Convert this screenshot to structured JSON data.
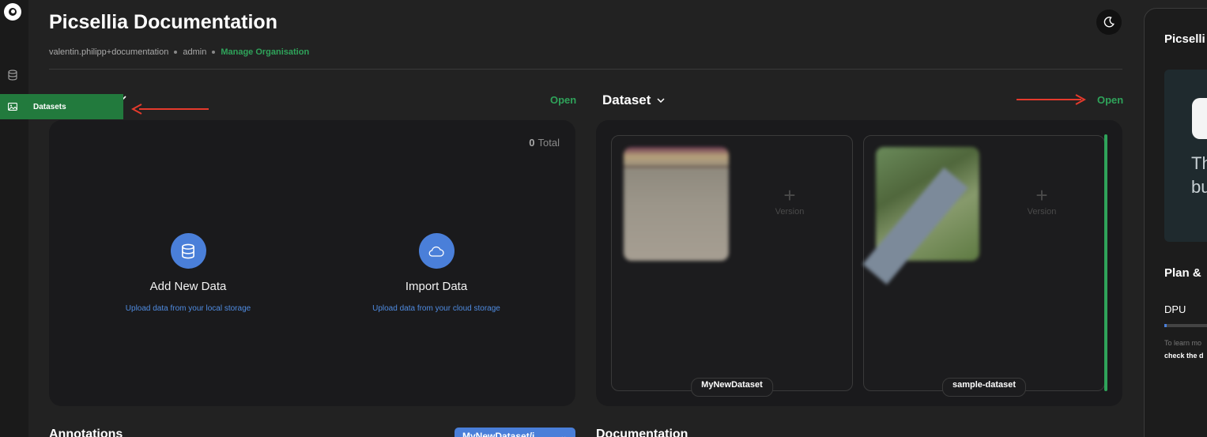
{
  "header": {
    "title": "Picsellia Documentation",
    "user": "valentin.philipp+documentation",
    "role": "admin",
    "manage_link": "Manage Organisation"
  },
  "sidebar": {
    "tooltip_label": "Datasets"
  },
  "left_section": {
    "open_label": "Open",
    "total_count": "0",
    "total_label": "Total",
    "add_new_data": {
      "label": "Add New Data",
      "sub": "Upload data from your local storage"
    },
    "import_data": {
      "label": "Import Data",
      "sub": "Upload data from your cloud storage"
    }
  },
  "dataset_section": {
    "title": "Dataset",
    "open_label": "Open",
    "datasets": [
      {
        "name": "MyNewDataset",
        "version_label": "Version"
      },
      {
        "name": "sample-dataset",
        "version_label": "Version"
      }
    ]
  },
  "bottom": {
    "annotations_title": "Annotations",
    "dataset_select": "MyNewDataset/i...",
    "documentation_title": "Documentation"
  },
  "right_panel": {
    "title": "Picselli",
    "banner_line1": "Th",
    "banner_line2": "bu",
    "plan_title": "Plan &",
    "dpu_label": "DPU",
    "dpu_fraction": 0.03,
    "learn_text": "To learn mo",
    "check_text": "check the d"
  },
  "colors": {
    "accent_green": "#2fa35a",
    "accent_blue": "#4a7fd9",
    "arrow_red": "#e53a2c"
  }
}
